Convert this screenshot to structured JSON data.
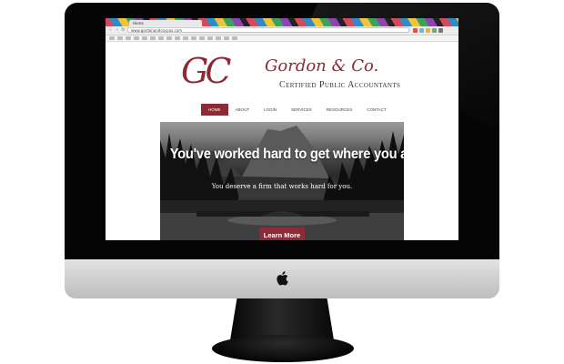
{
  "browser": {
    "tab_title": "Home",
    "url": "www.gordonandcocpas.com"
  },
  "site": {
    "logo_initials": "GC",
    "logo_name": "Gordon & Co.",
    "tagline": "Certified Public Accountants",
    "brand_color": "#8c2a35"
  },
  "nav": {
    "items": [
      {
        "label": "Home",
        "active": true
      },
      {
        "label": "About"
      },
      {
        "label": "Login"
      },
      {
        "label": "Services"
      },
      {
        "label": "Resources"
      },
      {
        "label": "Contact"
      }
    ]
  },
  "hero": {
    "title": "You've worked hard to get where you are.",
    "subtitle": "You deserve a firm that works hard for you.",
    "button_label": "Learn More"
  },
  "icons": {
    "apple": "apple-logo-icon",
    "back": "back-arrow-icon",
    "forward": "forward-arrow-icon",
    "reload": "reload-icon"
  }
}
